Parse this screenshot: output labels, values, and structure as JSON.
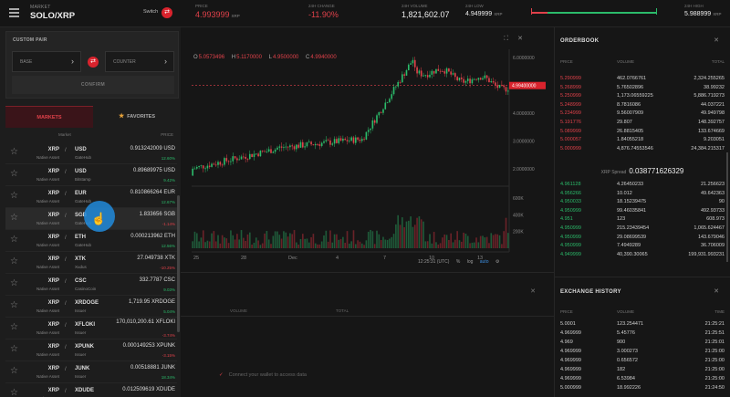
{
  "market": {
    "label": "MARKET",
    "pair": "SOLO/XRP",
    "switch_label": "Switch"
  },
  "custom_pair": {
    "title": "CUSTOM PAIR",
    "base_label": "BASE",
    "counter_label": "COUNTER",
    "confirm_label": "CONFIRM"
  },
  "tabs": {
    "markets": "MARKETS",
    "favorites": "FAVORITES"
  },
  "market_list_headers": {
    "market": "Market",
    "price": "PRICE"
  },
  "markets": [
    {
      "base": "XRP",
      "base_sub": "Native Asset",
      "currency": "USD",
      "issuer": "GateHub",
      "price": "0.913242009 USD",
      "change": "12.60%",
      "dir": "pos"
    },
    {
      "base": "XRP",
      "base_sub": "Native Asset",
      "currency": "USD",
      "issuer": "Bitstamp",
      "price": "0.89689975 USD",
      "change": "9.42%",
      "dir": "pos"
    },
    {
      "base": "XRP",
      "base_sub": "Native Asset",
      "currency": "EUR",
      "issuer": "GateHub",
      "price": "0.810866264 EUR",
      "change": "12.67%",
      "dir": "pos"
    },
    {
      "base": "XRP",
      "base_sub": "Native Asset",
      "currency": "SGB",
      "issuer": "GateHub",
      "price": "1.833656 SGB",
      "change": "-1.14%",
      "dir": "neg"
    },
    {
      "base": "XRP",
      "base_sub": "Native Asset",
      "currency": "ETH",
      "issuer": "GateHub",
      "price": "0.000213962 ETH",
      "change": "12.56%",
      "dir": "pos"
    },
    {
      "base": "XRP",
      "base_sub": "Native Asset",
      "currency": "XTK",
      "issuer": "Xudus",
      "price": "27.049738 XTK",
      "change": "-10.25%",
      "dir": "neg"
    },
    {
      "base": "XRP",
      "base_sub": "Native Asset",
      "currency": "CSC",
      "issuer": "CasinoCoin",
      "price": "332.7787 CSC",
      "change": "9.03%",
      "dir": "pos"
    },
    {
      "base": "XRP",
      "base_sub": "Native Asset",
      "currency": "XRDOGE",
      "issuer": "Issuer",
      "price": "1,719.95 XRDOGE",
      "change": "5.04%",
      "dir": "pos"
    },
    {
      "base": "XRP",
      "base_sub": "Native Asset",
      "currency": "XFLOKI",
      "issuer": "Issuer",
      "price": "170,010,200.61 XFLOKI",
      "change": "-3.74%",
      "dir": "neg"
    },
    {
      "base": "XRP",
      "base_sub": "Native Asset",
      "currency": "XPUNK",
      "issuer": "Issuer",
      "price": "0.000149253 XPUNK",
      "change": "-3.15%",
      "dir": "neg"
    },
    {
      "base": "XRP",
      "base_sub": "Native Asset",
      "currency": "JUNK",
      "issuer": "Issuer",
      "price": "0.00518881 JUNK",
      "change": "18.34%",
      "dir": "pos"
    },
    {
      "base": "XRP",
      "base_sub": "Native Asset",
      "currency": "XDUDE",
      "issuer": "",
      "price": "0.012509619 XDUDE",
      "change": "",
      "dir": "pos"
    }
  ],
  "stats": {
    "price": {
      "label": "PRICE",
      "value": "4.993999",
      "unit": "XRP"
    },
    "change_24h": {
      "label": "24H CHANGE",
      "value": "-11.90%"
    },
    "volume_24h": {
      "label": "24H VOLUME",
      "value": "1,821,602.07"
    },
    "low_24h": {
      "label": "24H LOW",
      "value": "4.949999",
      "unit": "XRP"
    },
    "high_24h": {
      "label": "24H HIGH",
      "value": "5.988999",
      "unit": "XRP"
    }
  },
  "chart": {
    "ohlc": {
      "o_label": "O",
      "o": "5.0573496",
      "h_label": "H",
      "h": "5.1170000",
      "l_label": "L",
      "l": "4.9500000",
      "c_label": "C",
      "c": "4.9940000"
    },
    "price_ticks": [
      "6.0000000",
      "5.0000000",
      "4.0000000",
      "3.0000000",
      "2.0000000"
    ],
    "current_price_label": "4.99400000",
    "volume_ticks": [
      "600K",
      "400K",
      "200K"
    ],
    "date_ticks": [
      "25",
      "28",
      "Dec",
      "4",
      "7",
      "10",
      "13"
    ],
    "time_label": "12:25:31 (UTC)",
    "percent_label": "%",
    "log_label": "log",
    "auto_label": "auto"
  },
  "orders": {
    "headers": {
      "volume": "VOLUME",
      "total": "TOTAL"
    },
    "connect_message": "Connect your wallet to access data"
  },
  "orderbook": {
    "title": "ORDERBOOK",
    "headers": {
      "price": "PRICE",
      "volume": "VOLUME",
      "total": "TOTAL"
    },
    "asks": [
      {
        "price": "5.290999",
        "volume": "462.0766761",
        "total": "2,324.255265"
      },
      {
        "price": "5.268999",
        "volume": "5.76502896",
        "total": "38.99232"
      },
      {
        "price": "5.250999",
        "volume": "1,173.06559225",
        "total": "5,886.719273"
      },
      {
        "price": "5.248999",
        "volume": "8.7816086",
        "total": "44.037221"
      },
      {
        "price": "5.234999",
        "volume": "9.56007909",
        "total": "49.949798"
      },
      {
        "price": "5.191776",
        "volume": "29.807",
        "total": "148.392757"
      },
      {
        "price": "5.089999",
        "volume": "26.8815405",
        "total": "133.674669"
      },
      {
        "price": "5.000057",
        "volume": "1.84055218",
        "total": "9.203051"
      },
      {
        "price": "5.000999",
        "volume": "4,876.74553546",
        "total": "24,384.215317"
      }
    ],
    "spread_label": "XRP Spread",
    "spread_value": "0.038771626329",
    "bids": [
      {
        "price": "4.961128",
        "volume": "4.26450233",
        "total": "21.256623"
      },
      {
        "price": "4.956266",
        "volume": "10.012",
        "total": "49.642363"
      },
      {
        "price": "4.950033",
        "volume": "18.15239475",
        "total": "90"
      },
      {
        "price": "4.950999",
        "volume": "99.46035841",
        "total": "492.93733"
      },
      {
        "price": "4.951",
        "volume": "123",
        "total": "608.973"
      },
      {
        "price": "4.950999",
        "volume": "215.23439454",
        "total": "1,065.624467"
      },
      {
        "price": "4.950999",
        "volume": "29.08699539",
        "total": "143.679046"
      },
      {
        "price": "4.950999",
        "volume": "7.4949289",
        "total": "36.706009"
      },
      {
        "price": "4.949999",
        "volume": "40,390.30065",
        "total": "199,931.993231"
      }
    ]
  },
  "exchange_history": {
    "title": "EXCHANGE HISTORY",
    "headers": {
      "price": "PRICE",
      "volume": "VOLUME",
      "time": "TIME"
    },
    "rows": [
      {
        "price": "5.0001",
        "volume": "123.254471",
        "time": "21:25:21",
        "dir": "pos"
      },
      {
        "price": "4.969999",
        "volume": "5.45776",
        "time": "21:25:51",
        "dir": "neg"
      },
      {
        "price": "4.969",
        "volume": "900",
        "time": "21:25:01",
        "dir": "neg"
      },
      {
        "price": "4.969999",
        "volume": "3.000273",
        "time": "21:25:00",
        "dir": "pos"
      },
      {
        "price": "4.969999",
        "volume": "0.656572",
        "time": "21:25:00",
        "dir": "neg"
      },
      {
        "price": "4.969999",
        "volume": "182",
        "time": "21:25:00",
        "dir": "neg"
      },
      {
        "price": "4.969999",
        "volume": "6.53984",
        "time": "21:25:00",
        "dir": "neg"
      },
      {
        "price": "5.000999",
        "volume": "18.992226",
        "time": "21:24:50",
        "dir": "pos"
      }
    ]
  },
  "colors": {
    "accent": "#e0414a",
    "positive": "#2bbb6a",
    "cursor": "#218bdc",
    "favorite_star": "#e8a33a"
  }
}
